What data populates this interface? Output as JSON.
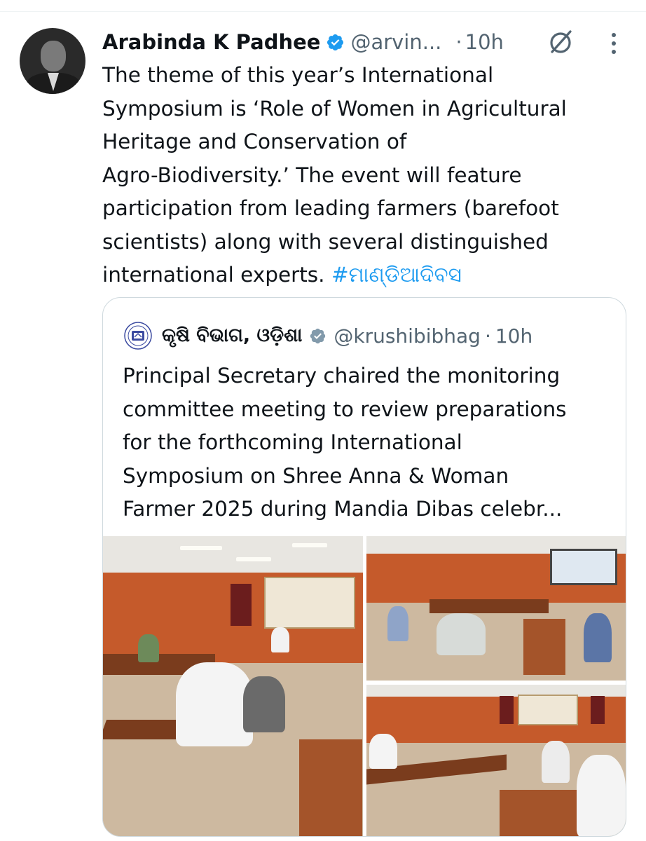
{
  "tweet": {
    "author_name": "Arabinda K Padhee",
    "handle": "@arvin...",
    "separator": "·",
    "time": "10h",
    "text_lines": [
      "The theme of this year’s International",
      "Symposium is ‘Role of Women in Agricultural",
      "Heritage and Conservation of",
      "Agro-Biodiversity.’ The event will feature",
      "participation from leading farmers (barefoot",
      "scientists) along with several distinguished"
    ],
    "last_line_text": "international experts. ",
    "hashtag": "#ମାଣ୍ଡିଆଦିବସ",
    "icons": [
      "verified-badge-icon",
      "grok-icon",
      "more-icon"
    ]
  },
  "quote": {
    "author_name": "କୃଷି ବିଭାଗ, ଓଡ଼ିଶା",
    "handle": "@krushibibhag",
    "separator": "·",
    "time": "10h",
    "text_lines": [
      "Principal Secretary chaired the monitoring",
      "committee meeting to review preparations",
      "for the forthcoming International",
      "Symposium on Shree Anna & Woman",
      "Farmer 2025 during Mandia Dibas celebr..."
    ],
    "photo_count": 3
  },
  "colors": {
    "text": "#0f1419",
    "secondary": "#536471",
    "link": "#1d9bf0",
    "border": "#cfd9de",
    "verified": "#1d9bf0"
  }
}
